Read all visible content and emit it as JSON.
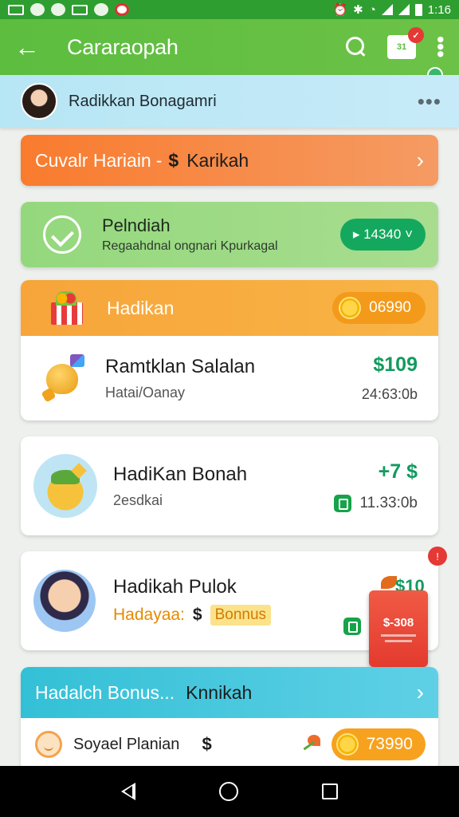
{
  "status_bar": {
    "time": "1:16"
  },
  "app_bar": {
    "title": "Cararaopah",
    "calendar_text": "31",
    "calendar_badge": "✓"
  },
  "user": {
    "name": "Radikkan Bonagamri"
  },
  "banner_top": {
    "text": "Cuvalr Hariain",
    "separator": "-",
    "currency": "$",
    "suffix": "Karikah"
  },
  "pending": {
    "title": "Pelndiah",
    "subtitle": "Regaahdnal ongnari Kpurkagal",
    "pill": "▸ 14340 ˅"
  },
  "gift_section": {
    "title": "Hadikan",
    "pill_value": "06990",
    "row": {
      "title": "Ramtklan Salalan",
      "subtitle": "Hatai/Oanay",
      "amount": "$109",
      "time": "24:63:0b"
    }
  },
  "bonus_row": {
    "title": "HadiKan Bonah",
    "subtitle": "2esdkai",
    "amount": "+7 $",
    "time": "11.33:0b"
  },
  "promo_row": {
    "title": "Hadikah Pulok",
    "subtitle_text": "Hadayaa:",
    "currency": "$",
    "tag": "Bonnus",
    "amount": "$10",
    "corner_badge": "!",
    "coupon_value": "$-308"
  },
  "teal_section": {
    "title": "Hadalch Bonus...",
    "suffix": "Knnikah",
    "row": {
      "label": "Soyael Planian",
      "currency": "$",
      "pill_value": "73990"
    }
  },
  "colors": {
    "appbar": "#5cbd3f",
    "orange_banner": "#f97b2e",
    "green_card": "#94d87d",
    "gift_header": "#f7a53a",
    "teal_header": "#33c0d6",
    "amount_green": "#129b5f"
  }
}
